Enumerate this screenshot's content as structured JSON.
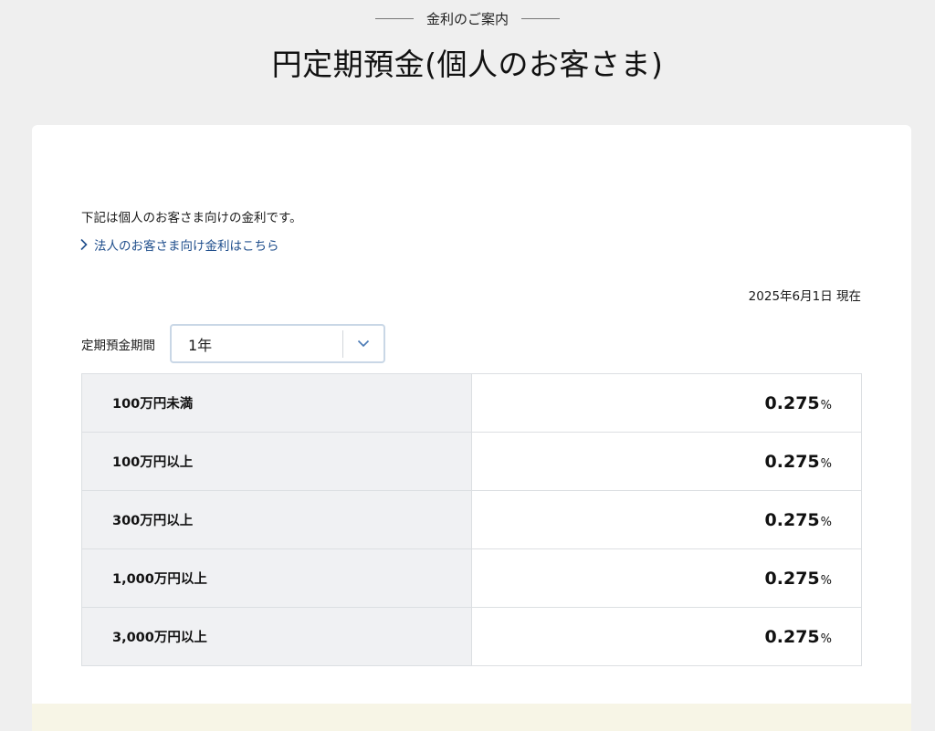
{
  "header": {
    "eyebrow": "金利のご案内",
    "title": "円定期預金(個人のお客さま)"
  },
  "card": {
    "intro_text": "下記は個人のお客さま向けの金利です。",
    "corporate_link": "法人のお客さま向け金利はこちら",
    "as_of": "2025年6月1日 現在",
    "period": {
      "label": "定期預金期間",
      "selected": "1年"
    },
    "rates": [
      {
        "tier": "100万円未満",
        "rate": "0.275",
        "unit": "%"
      },
      {
        "tier": "100万円以上",
        "rate": "0.275",
        "unit": "%"
      },
      {
        "tier": "300万円以上",
        "rate": "0.275",
        "unit": "%"
      },
      {
        "tier": "1,000万円以上",
        "rate": "0.275",
        "unit": "%"
      },
      {
        "tier": "3,000万円以上",
        "rate": "0.275",
        "unit": "%"
      }
    ]
  },
  "colors": {
    "background": "#efefef",
    "link": "#1f4e8c",
    "tier_cell": "#f0f1f3",
    "select_border": "#c9d7e6"
  },
  "icons": {
    "link_arrow": "chevron-right-icon",
    "select_arrow": "chevron-down-icon"
  }
}
